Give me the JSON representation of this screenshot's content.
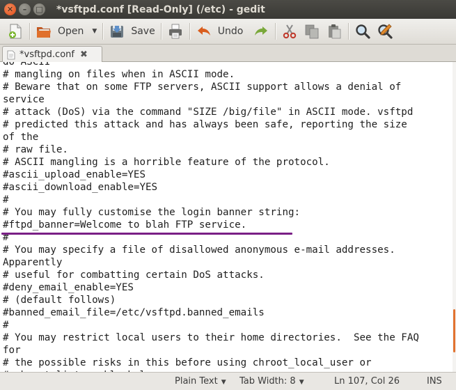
{
  "window": {
    "title": "*vsftpd.conf [Read-Only] (/etc) - gedit"
  },
  "toolbar": {
    "open_label": "Open",
    "save_label": "Save",
    "undo_label": "Undo"
  },
  "tabs": [
    {
      "label": "*vsftpd.conf"
    }
  ],
  "editor": {
    "lines": [
      "do ASCII",
      "# mangling on files when in ASCII mode.",
      "# Beware that on some FTP servers, ASCII support allows a denial of",
      "service",
      "# attack (DoS) via the command \"SIZE /big/file\" in ASCII mode. vsftpd",
      "# predicted this attack and has always been safe, reporting the size",
      "of the",
      "# raw file.",
      "# ASCII mangling is a horrible feature of the protocol.",
      "#ascii_upload_enable=YES",
      "#ascii_download_enable=YES",
      "#",
      "# You may fully customise the login banner string:",
      "#ftpd_banner=Welcome to blah FTP service.",
      "#",
      "# You may specify a file of disallowed anonymous e-mail addresses.",
      "Apparently",
      "# useful for combatting certain DoS attacks.",
      "#deny_email_enable=YES",
      "# (default follows)",
      "#banned_email_file=/etc/vsftpd.banned_emails",
      "#",
      "# You may restrict local users to their home directories.  See the FAQ",
      "for",
      "# the possible risks in this before using chroot_local_user or",
      "# chroot_list_enable below."
    ],
    "highlight_color": "#7a1f86"
  },
  "statusbar": {
    "language": "Plain Text",
    "tab_width": "Tab Width: 8",
    "position": "Ln 107, Col 26",
    "mode": "INS"
  },
  "colors": {
    "titlebar": "#3c3b37",
    "close_button": "#df4a16",
    "scroll_thumb": "#e2722f"
  },
  "icons": [
    "new-document-icon",
    "open-folder-icon",
    "save-icon",
    "print-icon",
    "undo-icon",
    "redo-icon",
    "cut-icon",
    "copy-icon",
    "paste-icon",
    "find-icon",
    "replace-icon"
  ]
}
